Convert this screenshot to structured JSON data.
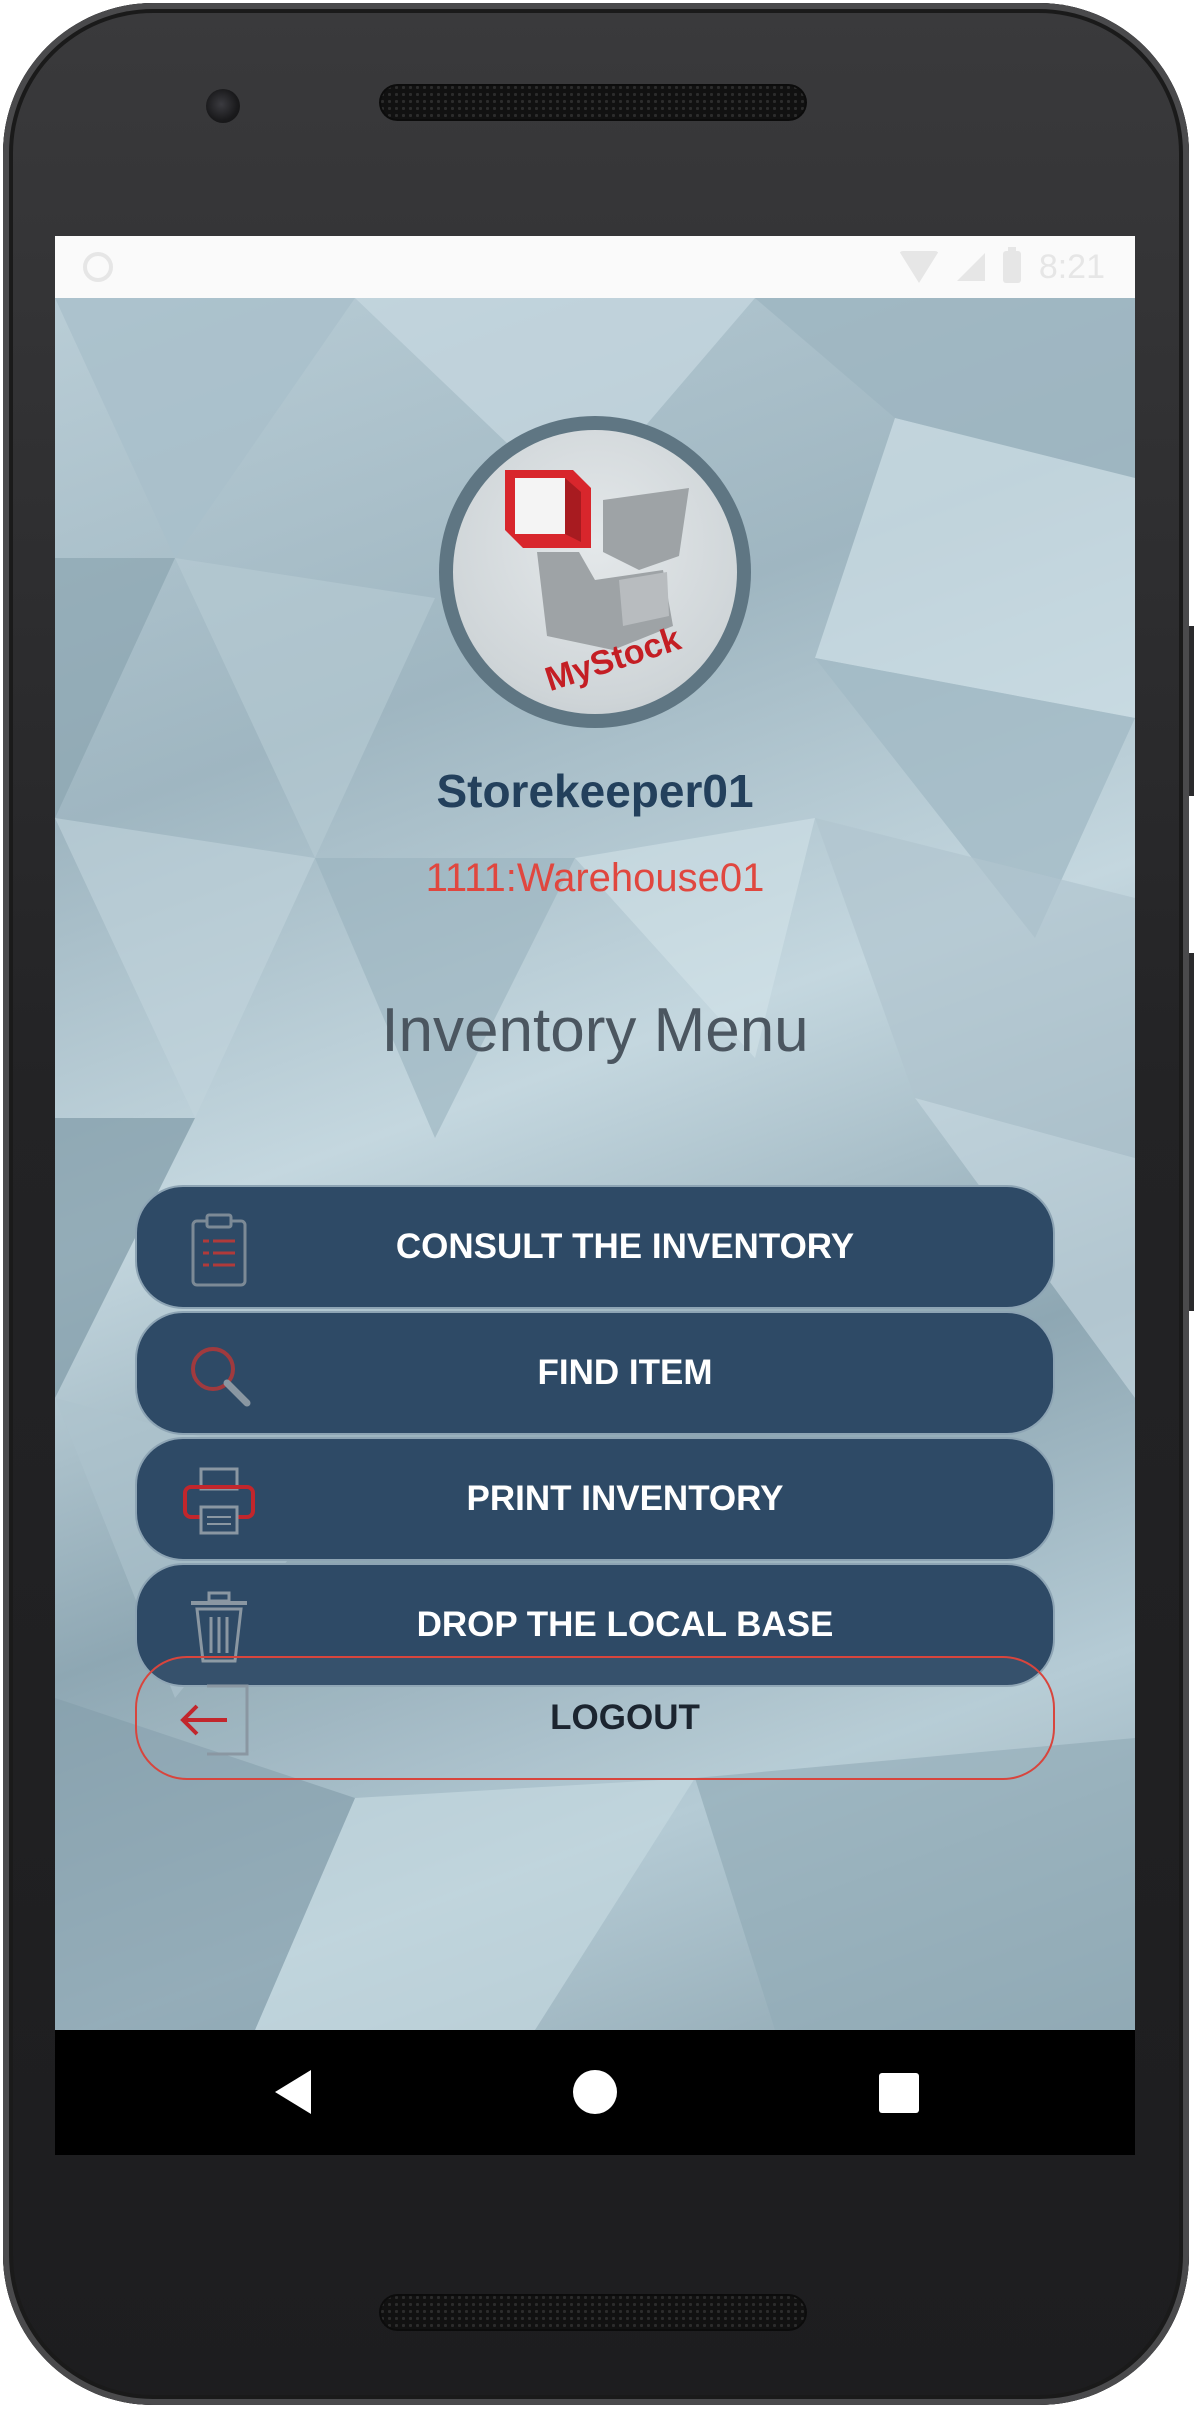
{
  "status_bar": {
    "time": "8:21"
  },
  "profile": {
    "logo_text": "MyStock",
    "username": "Storekeeper01",
    "warehouse": "1111:Warehouse01"
  },
  "menu": {
    "title": "Inventory Menu",
    "items": [
      {
        "label": "CONSULT THE INVENTORY",
        "icon": "clipboard-icon"
      },
      {
        "label": "FIND ITEM",
        "icon": "search-icon"
      },
      {
        "label": "PRINT INVENTORY",
        "icon": "printer-icon"
      },
      {
        "label": "DROP THE LOCAL BASE",
        "icon": "trash-icon"
      }
    ],
    "logout_label": "LOGOUT"
  },
  "colors": {
    "button_bg": "#2e4a66",
    "username": "#23405c",
    "warehouse": "#e0473f",
    "logout_border": "#d8453d"
  }
}
